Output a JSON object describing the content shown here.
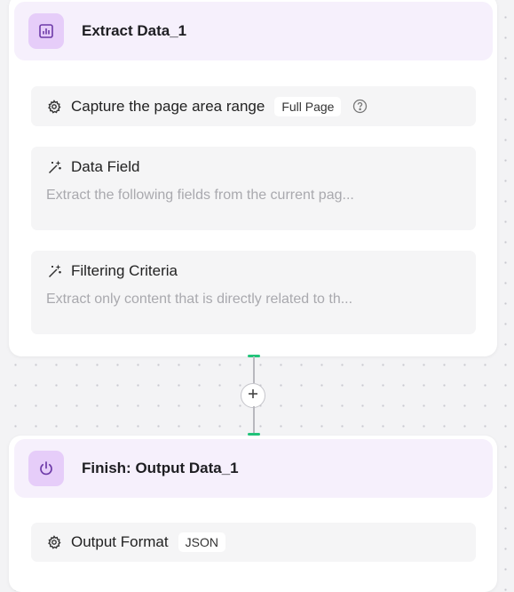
{
  "extract_node": {
    "title": "Extract Data_1",
    "icon": "bar-chart-icon",
    "fields": {
      "capture": {
        "label": "Capture the page area range",
        "icon": "gear-icon",
        "value": "Full Page",
        "help_icon": "help-icon"
      },
      "data_field": {
        "label": "Data Field",
        "icon": "magic-wand-icon",
        "description": "Extract the following fields from the current pag..."
      },
      "filtering": {
        "label": "Filtering Criteria",
        "icon": "magic-wand-icon",
        "description": "Extract only content that is directly related to th..."
      }
    }
  },
  "connector": {
    "add_icon": "plus-icon",
    "handle_color": "#22c47a"
  },
  "finish_node": {
    "title": "Finish: Output Data_1",
    "icon": "power-icon",
    "fields": {
      "output_format": {
        "label": "Output Format",
        "icon": "gear-icon",
        "value": "JSON"
      }
    }
  },
  "colors": {
    "header_bg": "#f6f0fc",
    "icon_bg": "#e6cdf9",
    "field_bg": "#f5f5f6",
    "canvas_bg": "#f3f3f5"
  }
}
